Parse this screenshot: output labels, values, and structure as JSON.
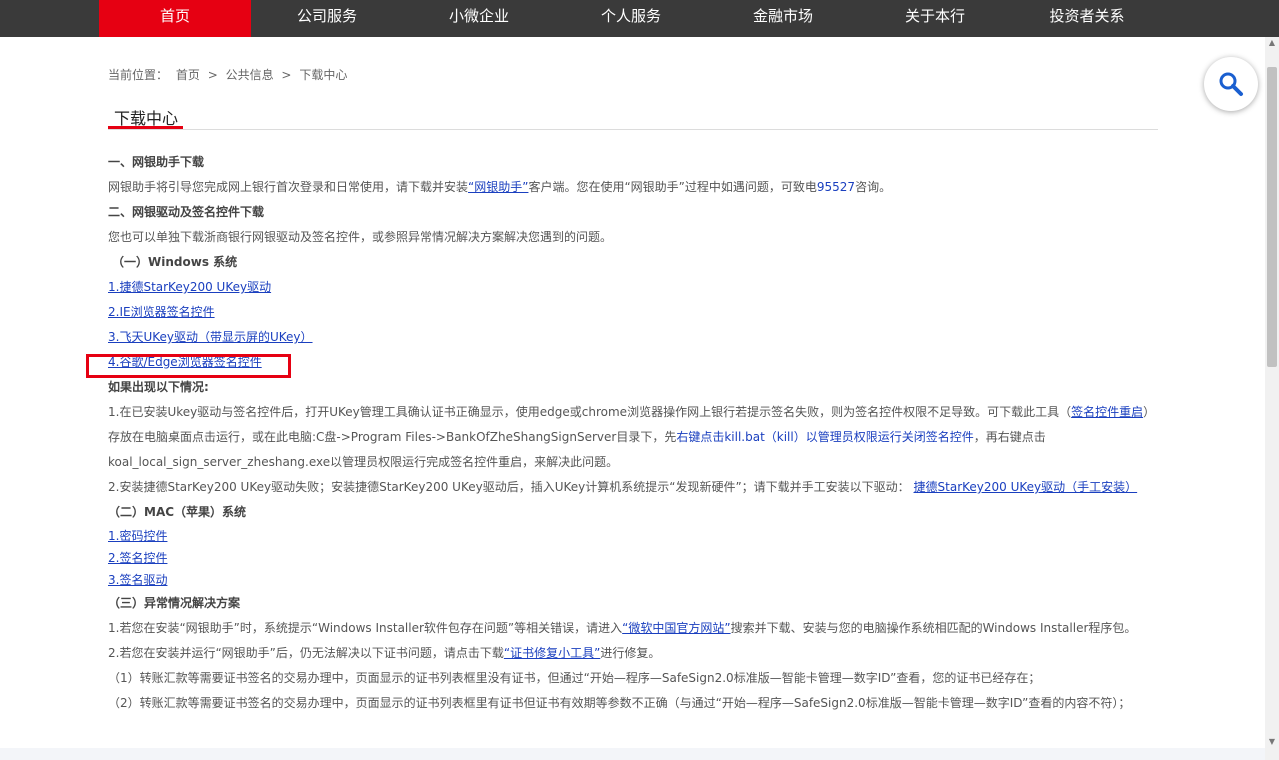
{
  "nav": {
    "items": [
      {
        "label": "首页",
        "active": true
      },
      {
        "label": "公司服务"
      },
      {
        "label": "小微企业"
      },
      {
        "label": "个人服务"
      },
      {
        "label": "金融市场"
      },
      {
        "label": "关于本行"
      },
      {
        "label": "投资者关系"
      }
    ]
  },
  "breadcrumb": {
    "prefix": "当前位置：",
    "home": "首页",
    "sep1": ">",
    "section": "公共信息",
    "sep2": ">",
    "current": "下载中心"
  },
  "page_title": "下载中心",
  "colors": {
    "accent": "#e60012",
    "link": "#1a3fbf",
    "nav_bg": "#3a3a3a"
  },
  "content": {
    "s1_title": "一、网银助手下载",
    "s1_text_a": "网银助手将引导您完成网上银行首次登录和日常使用，请下载并安装",
    "s1_link": "“网银助手”",
    "s1_text_b": "客户端。您在使用“网银助手”过程中如遇问题，可致电",
    "s1_phone": "95527",
    "s1_text_c": "咨询。",
    "s2_title": "二、网银驱动及签名控件下载",
    "s2_text": "您也可以单独下载浙商银行网银驱动及签名控件，或参照异常情况解决方案解决您遇到的问题。",
    "win_title": "（一）Windows 系统",
    "win_links": [
      "1.捷德StarKey200 UKey驱动",
      "2.IE浏览器签名控件",
      "3.飞天UKey驱动（带显示屏的UKey）",
      "4.谷歌/Edge浏览器签名控件"
    ],
    "case_title": "如果出现以下情况:",
    "case1_a": "1.在已安装Ukey驱动与签名控件后，打开UKey管理工具确认证书正确显示，使用edge或chrome浏览器操作网上银行若提示签名失败，则为签名控件权限不足导致。可下载此工具（",
    "case1_link": "签名控件重启",
    "case1_b": "）存放在电脑桌面点击运行，或在此电脑:C盘->Program Files->BankOfZheShangSignServer目录下，先",
    "case1_blue": "右键点击kill.bat（kill）以管理员权限运行关闭签名控件",
    "case1_c": "，再右键点击koal_local_sign_server_zheshang.exe以管理员权限运行完成签名控件重启，来解决此问题。",
    "case2_a": "2.安装捷德StarKey200 UKey驱动失败；安装捷德StarKey200 UKey驱动后，插入UKey计算机系统提示“发现新硬件”；请下载并手工安装以下驱动：",
    "case2_link": "捷德StarKey200 UKey驱动（手工安装）",
    "mac_title": "（二）MAC（苹果）系统",
    "mac_links": [
      "1.密码控件",
      "2.签名控件",
      "3.签名驱动"
    ],
    "s3_title": "（三）异常情况解决方案",
    "s3_p1_a": "1.若您在安装“网银助手”时，系统提示“Windows Installer软件包存在问题”等相关错误，请进入",
    "s3_p1_link": "“微软中国官方网站”",
    "s3_p1_b": "搜索并下载、安装与您的电脑操作系统相匹配的Windows Installer程序包。",
    "s3_p2_a": "2.若您在安装并运行“网银助手”后，仍无法解决以下证书问题，请点击下载",
    "s3_p2_link": "“证书修复小工具”",
    "s3_p2_b": "进行修复。",
    "s3_p3": "（1）转账汇款等需要证书签名的交易办理中，页面显示的证书列表框里没有证书，但通过“开始—程序—SafeSign2.0标准版—智能卡管理—数字ID”查看，您的证书已经存在；",
    "s3_p4": "（2）转账汇款等需要证书签名的交易办理中，页面显示的证书列表框里有证书但证书有效期等参数不正确（与通过“开始—程序—SafeSign2.0标准版—智能卡管理—数字ID”查看的内容不符）；"
  }
}
